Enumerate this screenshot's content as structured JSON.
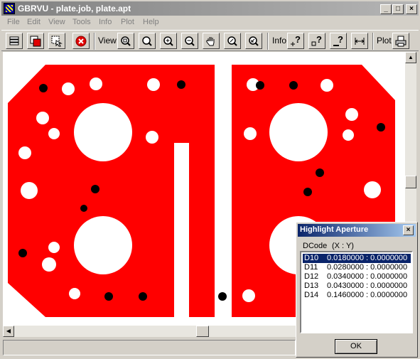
{
  "window": {
    "title": "GBRVU - plate.job, plate.apt",
    "minimize": "_",
    "maximize": "□",
    "close": "×"
  },
  "menu": [
    {
      "label": "File"
    },
    {
      "label": "Edit"
    },
    {
      "label": "View"
    },
    {
      "label": "Tools"
    },
    {
      "label": "Info"
    },
    {
      "label": "Plot"
    },
    {
      "label": "Help"
    }
  ],
  "toolbar": {
    "view_label": "View",
    "info_label": "Info",
    "plot_label": "Plot",
    "icons": [
      "layers-icon",
      "color-fill-icon",
      "select-arrow-icon",
      "stop-icon",
      "zoom-in-icon",
      "zoom-window-icon",
      "zoom-plus-icon",
      "zoom-minus-icon",
      "pan-hand-icon",
      "zoom-fit-icon",
      "zoom-previous-icon",
      "info-point-icon",
      "info-aperture-icon",
      "info-line-icon",
      "measure-icon",
      "print-icon"
    ]
  },
  "colors": {
    "copper": "#ff0000",
    "pad": "#ffffff",
    "drill": "#000000",
    "selection": "#0a246a"
  },
  "dialog": {
    "title": "Highlight Aperture",
    "close": "×",
    "col_dcode": "DCode",
    "col_xy": "(X : Y)",
    "rows": [
      {
        "dcode": "D10",
        "value": "0.0180000 : 0.0000000",
        "selected": true
      },
      {
        "dcode": "D11",
        "value": "0.0280000 : 0.0000000",
        "selected": false
      },
      {
        "dcode": "D12",
        "value": "0.0340000 : 0.0000000",
        "selected": false
      },
      {
        "dcode": "D13",
        "value": "0.0430000 : 0.0000000",
        "selected": false
      },
      {
        "dcode": "D14",
        "value": "0.1460000 : 0.0000000",
        "selected": false
      }
    ],
    "ok_label": "OK"
  }
}
